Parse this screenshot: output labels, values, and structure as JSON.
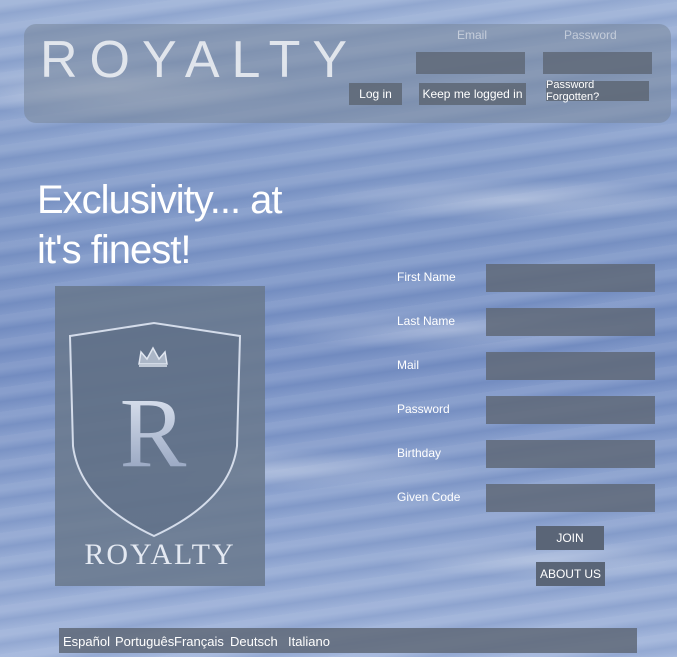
{
  "header": {
    "brand": "ROYALTY",
    "email_label": "Email",
    "password_label": "Password",
    "login_label": "Log in",
    "keep_logged_label": "Keep me logged in",
    "forgot_label": "Password Forgotten?"
  },
  "hero": {
    "tagline_line1": "Exclusivity... at",
    "tagline_line2": "it's finest!"
  },
  "crest": {
    "letter": "R",
    "name": "ROYALTY"
  },
  "form": {
    "fields": [
      {
        "label": "First Name",
        "value": ""
      },
      {
        "label": "Last Name",
        "value": ""
      },
      {
        "label": "Mail",
        "value": ""
      },
      {
        "label": "Password",
        "value": ""
      },
      {
        "label": "Birthday",
        "value": ""
      },
      {
        "label": "Given Code",
        "value": ""
      }
    ],
    "join_label": "JOIN",
    "about_label": "ABOUT US"
  },
  "footer": {
    "languages": [
      "Español",
      "Português",
      "Français",
      "Deutsch",
      "Italiano"
    ]
  },
  "colors": {
    "panel": "#5f6978",
    "button": "#5a6577",
    "text": "#ffffff"
  }
}
